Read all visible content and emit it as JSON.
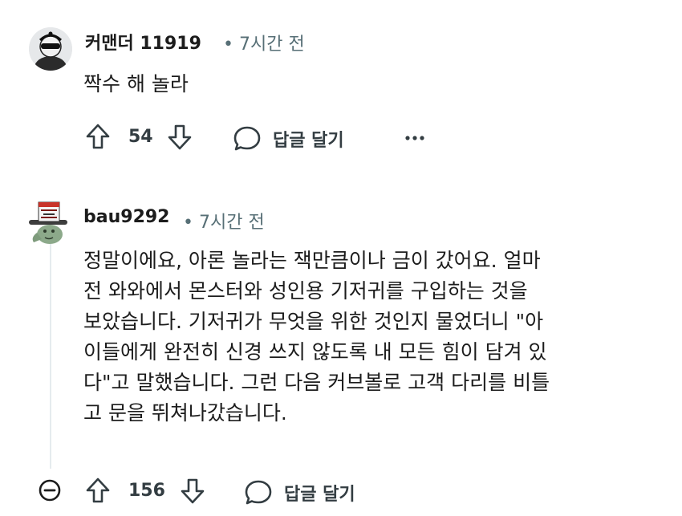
{
  "comments": [
    {
      "author": "커맨더 11919",
      "time": "• 7시간 전",
      "text": "짝수 해 놀라",
      "upvotes": "54",
      "reply_label": "답글 달기",
      "more_label": "···"
    },
    {
      "author": "bau9292",
      "time": "• 7시간 전",
      "text": "정말이에요, 아론 놀라는 잭만큼이나 금이 갔어요. 얼마\n전 와와에서 몬스터와 성인용 기저귀를 구입하는 것을\n보았습니다. 기저귀가 무엇을 위한 것인지 물었더니 \"아\n이들에게 완전히 신경 쓰지 않도록 내 모든 힘이 담겨 있\n다\"고 말했습니다. 그런 다음 커브볼로 고객 다리를 비틀\n고 문을 뛰쳐나갔습니다.",
      "upvotes": "156",
      "reply_label": "답글 달기"
    }
  ],
  "colors": {
    "text": "#1c1c1c",
    "meta": "#576f76",
    "action": "#333d42"
  },
  "icons": [
    "upvote-icon",
    "downvote-icon",
    "reply-bubble-icon",
    "more-options-icon",
    "collapse-thread-icon"
  ]
}
